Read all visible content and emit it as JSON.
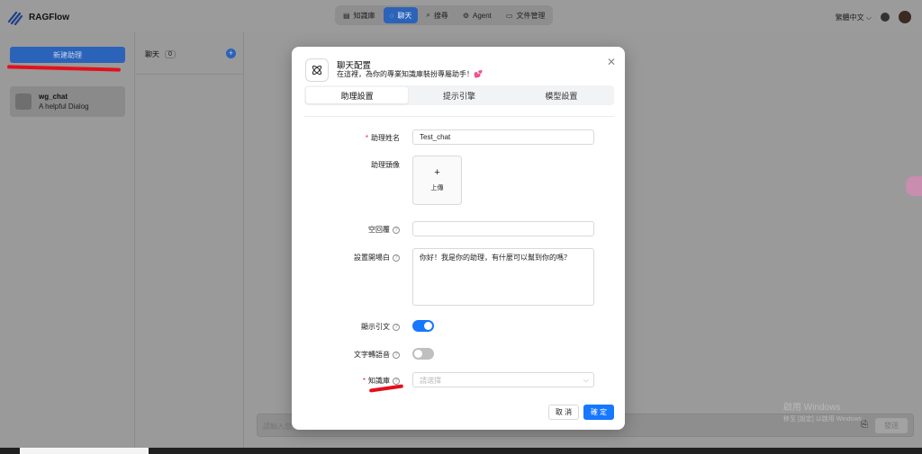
{
  "app": {
    "name": "RAGFlow",
    "nav": [
      {
        "icon": "database-icon",
        "label": "知識庫"
      },
      {
        "icon": "chat-icon",
        "label": "聊天",
        "active": true
      },
      {
        "icon": "search-icon",
        "label": "搜尋"
      },
      {
        "icon": "agent-icon",
        "label": "Agent"
      },
      {
        "icon": "folder-icon",
        "label": "文件管理"
      }
    ],
    "language": "繁體中文"
  },
  "sidebar": {
    "new_button": "新建助理",
    "chats": [
      {
        "name": "wg_chat",
        "description": "A helpful Dialog"
      }
    ]
  },
  "conversations": {
    "title": "聊天",
    "count": "0"
  },
  "chat_input": {
    "placeholder": "請輸入您",
    "send": "發送"
  },
  "watermark": {
    "line1": "啟用 Windows",
    "line2": "移至 [設定] 以啟用 Windows。"
  },
  "modal": {
    "title": "聊天配置",
    "subtitle": "在這裡，為你的專業知識庫裝扮專屬助手！💕",
    "tabs": [
      "助理設置",
      "提示引擎",
      "模型設置"
    ],
    "fields": {
      "name_label": "助理姓名",
      "name_value": "Test_chat",
      "avatar_label": "助理頭像",
      "upload_label": "上傳",
      "empty_reply_label": "空回覆",
      "opener_label": "設置開場白",
      "opener_value": "你好！我是你的助理，有什麼可以幫到你的嗎？",
      "show_quote_label": "顯示引文",
      "show_quote_on": true,
      "tts_label": "文字轉語音",
      "tts_on": false,
      "kb_label": "知識庫",
      "kb_placeholder": "請選擇"
    },
    "cancel": "取 消",
    "ok": "確 定"
  }
}
